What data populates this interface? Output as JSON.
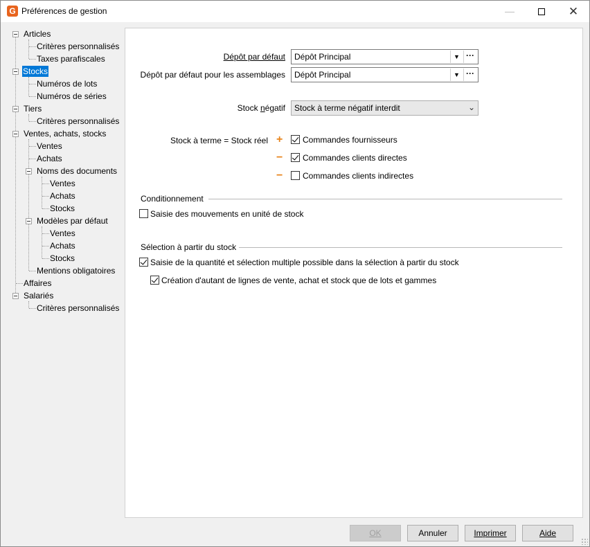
{
  "window": {
    "title": "Préférences de gestion",
    "icon_letter": "G",
    "accent_color": "#e8641e",
    "controls": {
      "minimize": "—",
      "close": "✕"
    }
  },
  "tree": {
    "items": [
      {
        "label": "Articles"
      },
      {
        "label": "Critères personnalisés"
      },
      {
        "label": "Taxes parafiscales"
      },
      {
        "label": "Stocks",
        "selected": true
      },
      {
        "label": "Numéros de lots"
      },
      {
        "label": "Numéros de séries"
      },
      {
        "label": "Tiers"
      },
      {
        "label": "Critères personnalisés"
      },
      {
        "label": "Ventes, achats, stocks"
      },
      {
        "label": "Ventes"
      },
      {
        "label": "Achats"
      },
      {
        "label": "Noms des documents"
      },
      {
        "label": "Ventes"
      },
      {
        "label": "Achats"
      },
      {
        "label": "Stocks"
      },
      {
        "label": "Modèles par défaut"
      },
      {
        "label": "Ventes"
      },
      {
        "label": "Achats"
      },
      {
        "label": "Stocks"
      },
      {
        "label": "Mentions obligatoires"
      },
      {
        "label": "Affaires"
      },
      {
        "label": "Salariés"
      },
      {
        "label": "Critères personnalisés"
      }
    ]
  },
  "form": {
    "depot_defaut": {
      "label": "Dépôt par défaut",
      "value": "Dépôt Principal"
    },
    "depot_assemblages": {
      "label": "Dépôt par défaut pour les assemblages",
      "value": "Dépôt Principal"
    },
    "stock_negatif": {
      "label_pre": "Stock ",
      "label_u": "n",
      "label_post": "égatif",
      "value": "Stock à terme négatif interdit"
    },
    "stock_terme": {
      "label": "Stock à terme = Stock réel",
      "rows": [
        {
          "op": "+",
          "label": "Commandes fournisseurs",
          "checked": true
        },
        {
          "op": "−",
          "label": "Commandes clients directes",
          "checked": true
        },
        {
          "op": "−",
          "label": "Commandes clients indirectes",
          "checked": false
        }
      ]
    },
    "conditionnement": {
      "title": "Conditionnement",
      "checkbox_label": "Saisie des mouvements en unité de stock",
      "checked": false
    },
    "selection": {
      "title": "Sélection à partir du stock",
      "checkbox1_label": "Saisie de la quantité et sélection multiple possible dans la sélection à partir du stock",
      "checkbox1_checked": true,
      "checkbox2_label": "Création d'autant de lignes de vente, achat et stock que de lots et gammes",
      "checkbox2_checked": true
    }
  },
  "buttons": {
    "ok": "OK",
    "annuler": "Annuler",
    "imprimer": "Imprimer",
    "aide": "Aide"
  },
  "operator_color": "#e8841c",
  "selection_color": "#0078d7"
}
